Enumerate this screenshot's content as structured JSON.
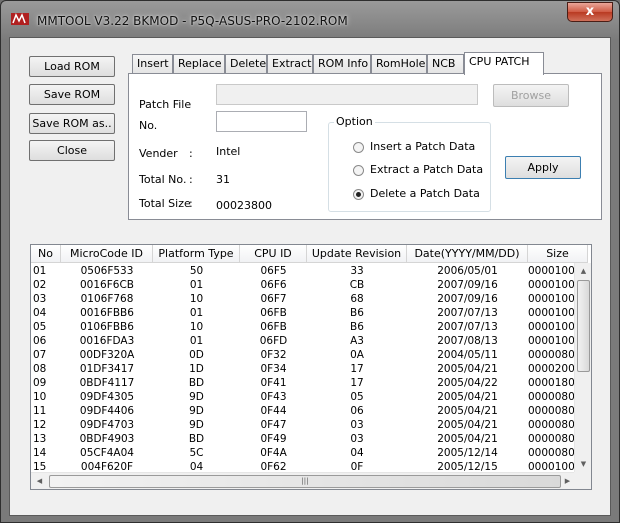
{
  "window": {
    "title": "MMTOOL V3.22 BKMOD - P5Q-ASUS-PRO-2102.ROM",
    "close_label": "x"
  },
  "sidebar": {
    "load_rom": "Load ROM",
    "save_rom": "Save ROM",
    "save_rom_as": "Save ROM as..",
    "close": "Close"
  },
  "tabs": [
    "Insert",
    "Replace",
    "Delete",
    "Extract",
    "ROM Info",
    "RomHole",
    "NCB",
    "CPU PATCH"
  ],
  "active_tab": "CPU PATCH",
  "patch": {
    "patch_file_label": "Patch File",
    "patch_file_value": "",
    "browse_label": "Browse",
    "no_label": "No.",
    "no_value": "",
    "vender_label": "Vender",
    "vender_sep": ":",
    "vender_value": "Intel",
    "total_no_label": "Total No.",
    "total_no_sep": ":",
    "total_no_value": "31",
    "total_size_label": "Total Size",
    "total_size_sep": ":",
    "total_size_value": "00023800",
    "option_title": "Option",
    "options": [
      "Insert a Patch Data",
      "Extract a Patch Data",
      "Delete a Patch Data"
    ],
    "selected_option": "Delete a Patch Data",
    "apply_label": "Apply"
  },
  "table": {
    "columns": [
      "No",
      "MicroCode ID",
      "Platform Type",
      "CPU ID",
      "Update Revision",
      "Date(YYYY/MM/DD)",
      "Size"
    ],
    "rows": [
      [
        "01",
        "0506F533",
        "50",
        "06F5",
        "33",
        "2006/05/01",
        "0000100"
      ],
      [
        "02",
        "0016F6CB",
        "01",
        "06F6",
        "CB",
        "2007/09/16",
        "0000100"
      ],
      [
        "03",
        "0106F768",
        "10",
        "06F7",
        "68",
        "2007/09/16",
        "0000100"
      ],
      [
        "04",
        "0016FBB6",
        "01",
        "06FB",
        "B6",
        "2007/07/13",
        "0000100"
      ],
      [
        "05",
        "0106FBB6",
        "10",
        "06FB",
        "B6",
        "2007/07/13",
        "0000100"
      ],
      [
        "06",
        "0016FDA3",
        "01",
        "06FD",
        "A3",
        "2007/08/13",
        "0000100"
      ],
      [
        "07",
        "00DF320A",
        "0D",
        "0F32",
        "0A",
        "2004/05/11",
        "0000080"
      ],
      [
        "08",
        "01DF3417",
        "1D",
        "0F34",
        "17",
        "2005/04/21",
        "0000200"
      ],
      [
        "09",
        "0BDF4117",
        "BD",
        "0F41",
        "17",
        "2005/04/22",
        "0000180"
      ],
      [
        "10",
        "09DF4305",
        "9D",
        "0F43",
        "05",
        "2005/04/21",
        "0000080"
      ],
      [
        "11",
        "09DF4406",
        "9D",
        "0F44",
        "06",
        "2005/04/21",
        "0000080"
      ],
      [
        "12",
        "09DF4703",
        "9D",
        "0F47",
        "03",
        "2005/04/21",
        "0000080"
      ],
      [
        "13",
        "0BDF4903",
        "BD",
        "0F49",
        "03",
        "2005/04/21",
        "0000080"
      ],
      [
        "14",
        "05CF4A04",
        "5C",
        "0F4A",
        "04",
        "2005/12/14",
        "0000080"
      ],
      [
        "15",
        "004F620F",
        "04",
        "0F62",
        "0F",
        "2005/12/15",
        "0000100"
      ]
    ]
  },
  "scrollbar": {
    "up_arrow": "▲",
    "down_arrow": "▼",
    "left_arrow": "◀",
    "right_arrow": "▶",
    "grip": "|||"
  },
  "colors": {
    "title_bar": "#7a7a7a",
    "close_button": "#c7472f",
    "dialog_bg": "#f0f0f0"
  }
}
